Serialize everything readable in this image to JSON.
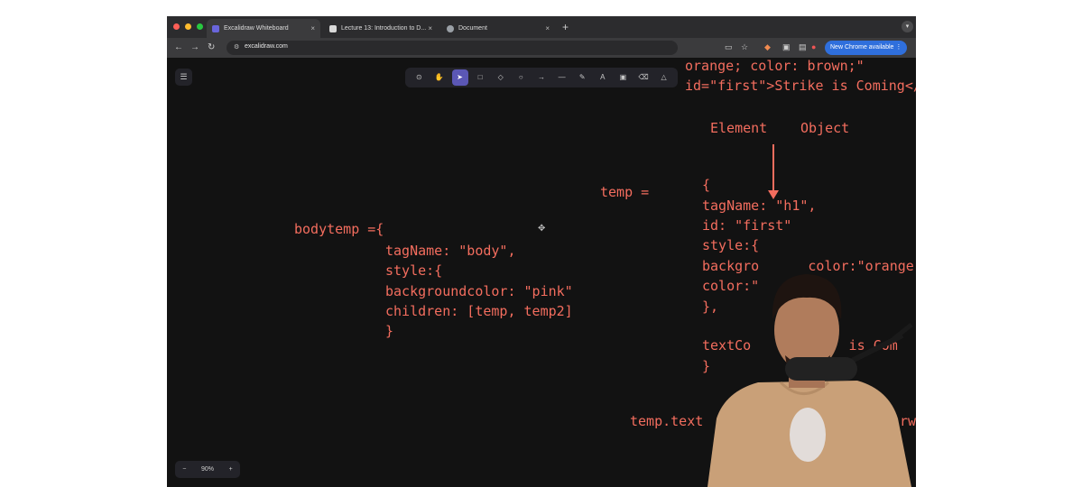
{
  "browser": {
    "tabs": [
      {
        "title": "Excalidraw Whiteboard",
        "close": "×"
      },
      {
        "title": "Lecture 13: Introduction to D...",
        "close": "×"
      },
      {
        "title": "Document",
        "close": "×"
      }
    ],
    "new_tab": "+",
    "url": "excalidraw.com",
    "update_button": "New Chrome available ⋮",
    "menu": "▾"
  },
  "canvas": {
    "zoom": {
      "minus": "−",
      "level": "90%",
      "plus": "+"
    },
    "top_lines": [
      "orange; color: brown;\"",
      "id=\"first\">Strike is Coming</h"
    ],
    "arrow_labels": {
      "left": "Element",
      "right": "Object"
    },
    "temp": {
      "label": "temp =",
      "lines": [
        "{",
        "tagName: \"h1\",",
        "id: \"first\"",
        "style:{",
        "backgro      color:\"orange\",",
        "color:\"",
        "},",
        "",
        "textCo            is Com",
        "}"
      ]
    },
    "bodytemp": {
      "label": "bodytemp ={",
      "lines": [
        "tagName: \"body\",",
        "style:{",
        "backgroundcolor: \"pink\"",
        "children: [temp, temp2]",
        "}"
      ]
    },
    "bottom_line": "temp.text",
    "bottom_right": "rw"
  },
  "colors": {
    "ink": "#f36d5e",
    "canvas_bg": "#121212",
    "accent": "#5b57b5"
  }
}
